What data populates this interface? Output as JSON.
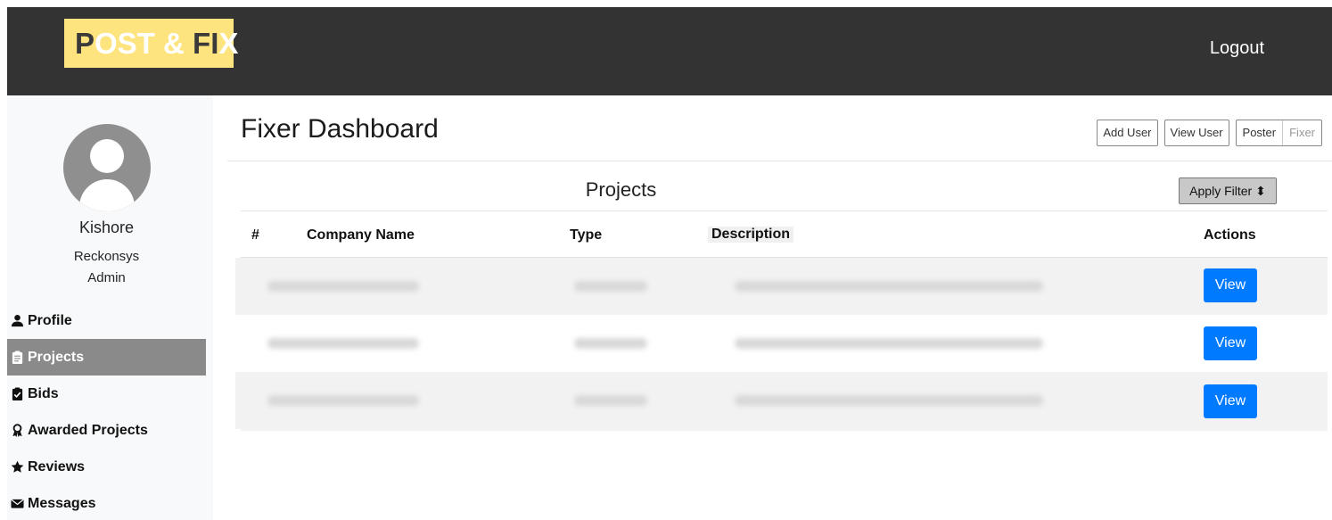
{
  "header": {
    "logo": {
      "p": "P",
      "ost": "OST ",
      "amp": "& ",
      "f": "F",
      "i": "I",
      "x": "X"
    },
    "logout_label": "Logout"
  },
  "user": {
    "name": "Kishore",
    "company": "Reckonsys",
    "role": "Admin"
  },
  "sidebar": {
    "items": [
      {
        "label": "Profile",
        "icon": "user-icon",
        "active": false
      },
      {
        "label": "Projects",
        "icon": "clipboard-icon",
        "active": true
      },
      {
        "label": "Bids",
        "icon": "clipboard-check-icon",
        "active": false
      },
      {
        "label": "Awarded Projects",
        "icon": "award-icon",
        "active": false
      },
      {
        "label": "Reviews",
        "icon": "star-icon",
        "active": false
      },
      {
        "label": "Messages",
        "icon": "envelope-icon",
        "active": false
      }
    ]
  },
  "main": {
    "title": "Fixer Dashboard",
    "buttons": {
      "add_user": "Add User",
      "view_user": "View User",
      "poster": "Poster",
      "fixer": "Fixer"
    },
    "section_title": "Projects",
    "filter_label": "Apply Filter ⬍",
    "table": {
      "columns": [
        "#",
        "Company Name",
        "Type",
        "Description",
        "Actions"
      ],
      "rows": [
        {
          "action": "View"
        },
        {
          "action": "View"
        },
        {
          "action": "View"
        }
      ]
    }
  },
  "colors": {
    "topbar": "#333333",
    "logo_bg": "#fde47f",
    "active_nav": "#8a8a8a",
    "primary": "#007bff"
  }
}
